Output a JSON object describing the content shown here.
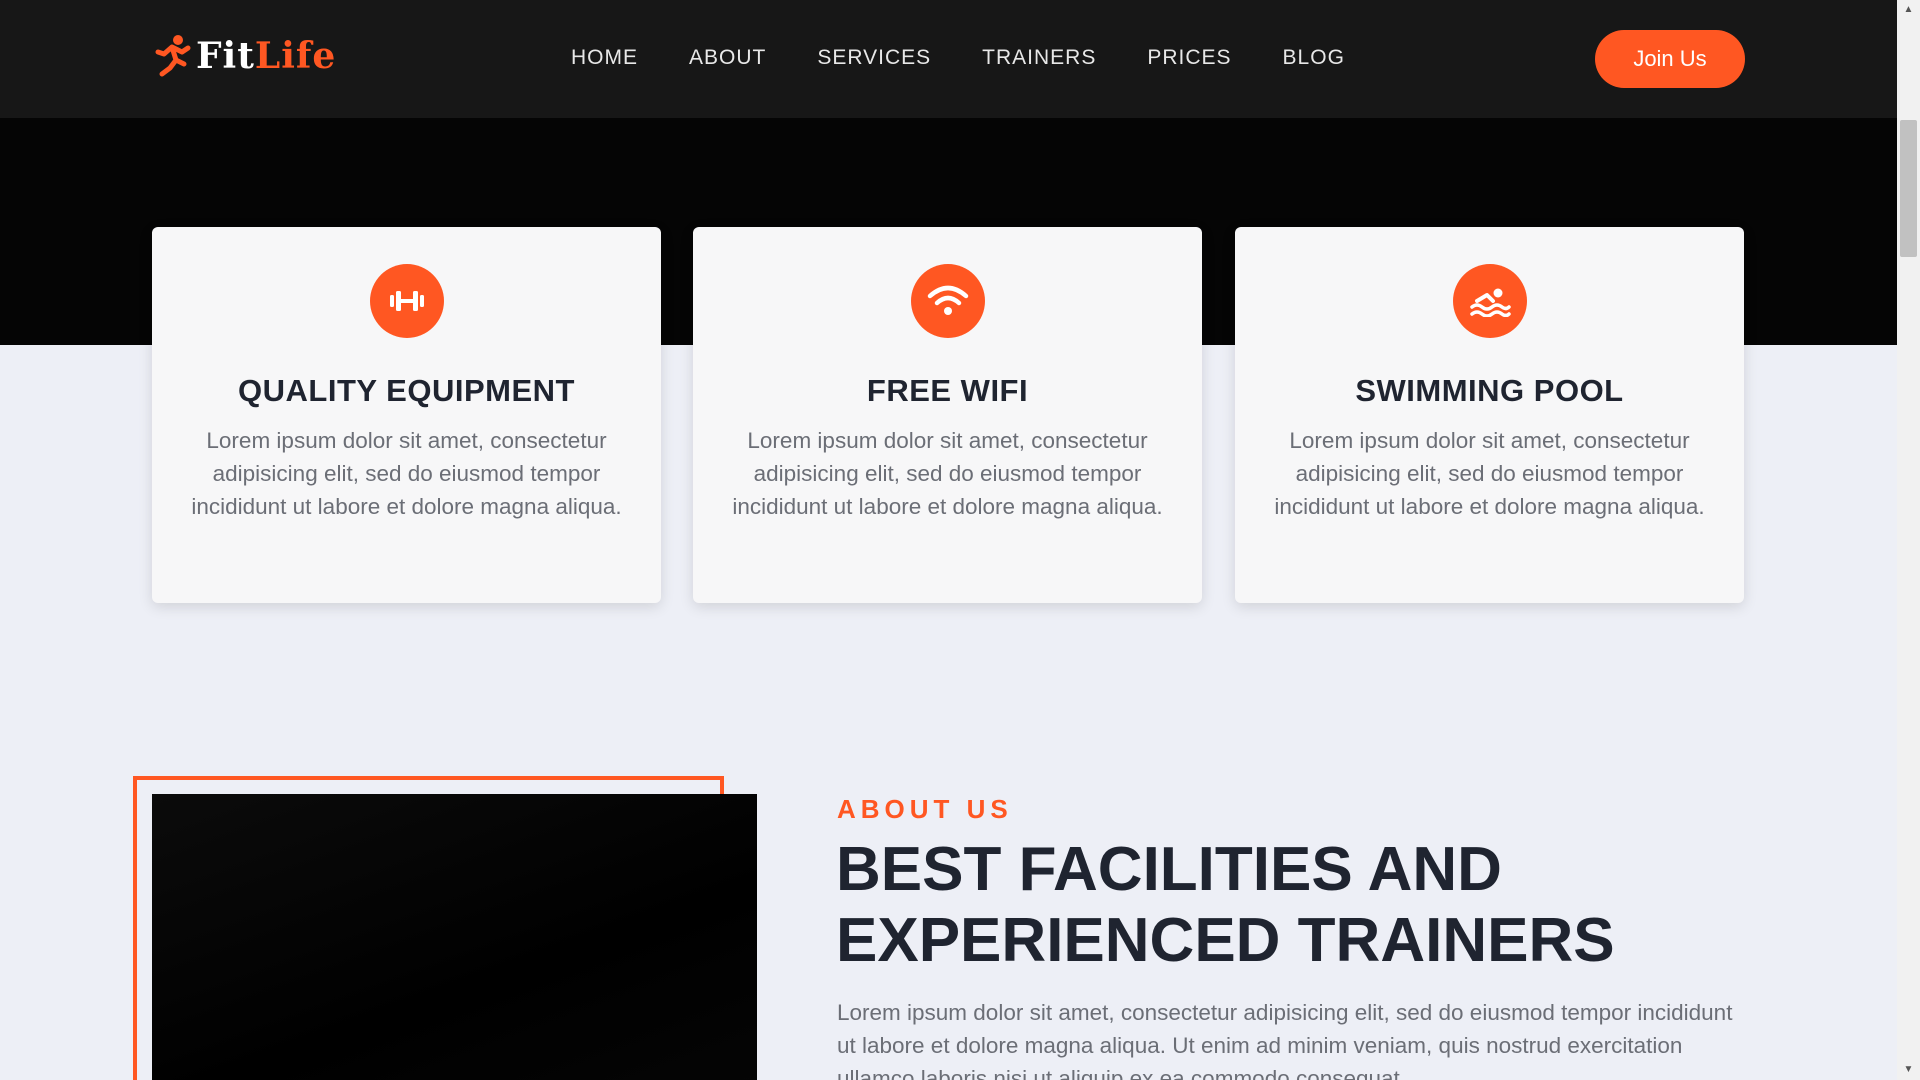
{
  "nav": {
    "logo_fit": "Fit",
    "logo_life": "Life",
    "items": [
      "HOME",
      "ABOUT",
      "SERVICES",
      "TRAINERS",
      "PRICES",
      "BLOG"
    ],
    "join_label": "Join Us"
  },
  "features": [
    {
      "title": "QUALITY EQUIPMENT",
      "text": "Lorem ipsum dolor sit amet, consectetur adipisicing elit, sed do eiusmod tempor incididunt ut labore et dolore magna aliqua.",
      "icon": "dumbbell-icon"
    },
    {
      "title": "FREE WIFI",
      "text": "Lorem ipsum dolor sit amet, consectetur adipisicing elit, sed do eiusmod tempor incididunt ut labore et dolore magna aliqua.",
      "icon": "wifi-icon"
    },
    {
      "title": "SWIMMING POOL",
      "text": "Lorem ipsum dolor sit amet, consectetur adipisicing elit, sed do eiusmod tempor incididunt ut labore et dolore magna aliqua.",
      "icon": "swimmer-icon"
    }
  ],
  "about": {
    "eyebrow": "ABOUT US",
    "title": "BEST FACILITIES AND EXPERIENCED TRAINERS",
    "text": "Lorem ipsum dolor sit amet, consectetur adipisicing elit, sed do eiusmod tempor incididunt ut labore et dolore magna aliqua. Ut enim ad minim veniam, quis nostrud exercitation ullamco laboris nisi ut aliquip ex ea commodo consequat."
  },
  "colors": {
    "accent": "#ff5722",
    "nav_bg": "#171717",
    "page_bg": "#edeff6"
  }
}
